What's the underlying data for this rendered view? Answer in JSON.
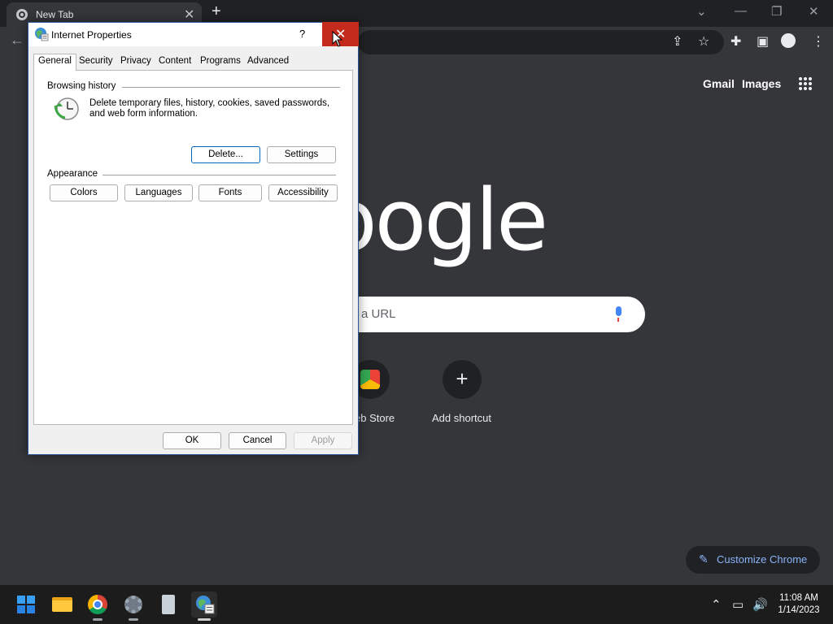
{
  "browser": {
    "tab_title": "New Tab",
    "new_tab_symbol": "+",
    "tab_close_symbol": "✕",
    "ntp": {
      "gmail": "Gmail",
      "images": "Images",
      "logo_text": "oogle",
      "search_placeholder": "a URL",
      "shortcuts": [
        {
          "label": "eb Store"
        },
        {
          "label": "Add shortcut",
          "symbol": "+"
        }
      ],
      "customize_label": "Customize Chrome"
    }
  },
  "dialog": {
    "title": "Internet Properties",
    "help": "?",
    "close": "✕",
    "tabs": [
      "General",
      "Security",
      "Privacy",
      "Content",
      "Programs",
      "Advanced"
    ],
    "active_tab": "General",
    "browsing_history": {
      "label": "Browsing history",
      "description": "Delete temporary files, history, cookies, saved passwords, and web form information.",
      "delete_button": "Delete...",
      "settings_button": "Settings"
    },
    "appearance": {
      "label": "Appearance",
      "buttons": [
        "Colors",
        "Languages",
        "Fonts",
        "Accessibility"
      ]
    },
    "footer": {
      "ok": "OK",
      "cancel": "Cancel",
      "apply": "Apply"
    }
  },
  "taskbar": {
    "clock_time": "11:08 AM",
    "clock_date": "1/14/2023"
  },
  "colors": {
    "close_red": "#c42b1c",
    "focus_blue": "#0067c0",
    "chrome_dark": "#35363a"
  }
}
